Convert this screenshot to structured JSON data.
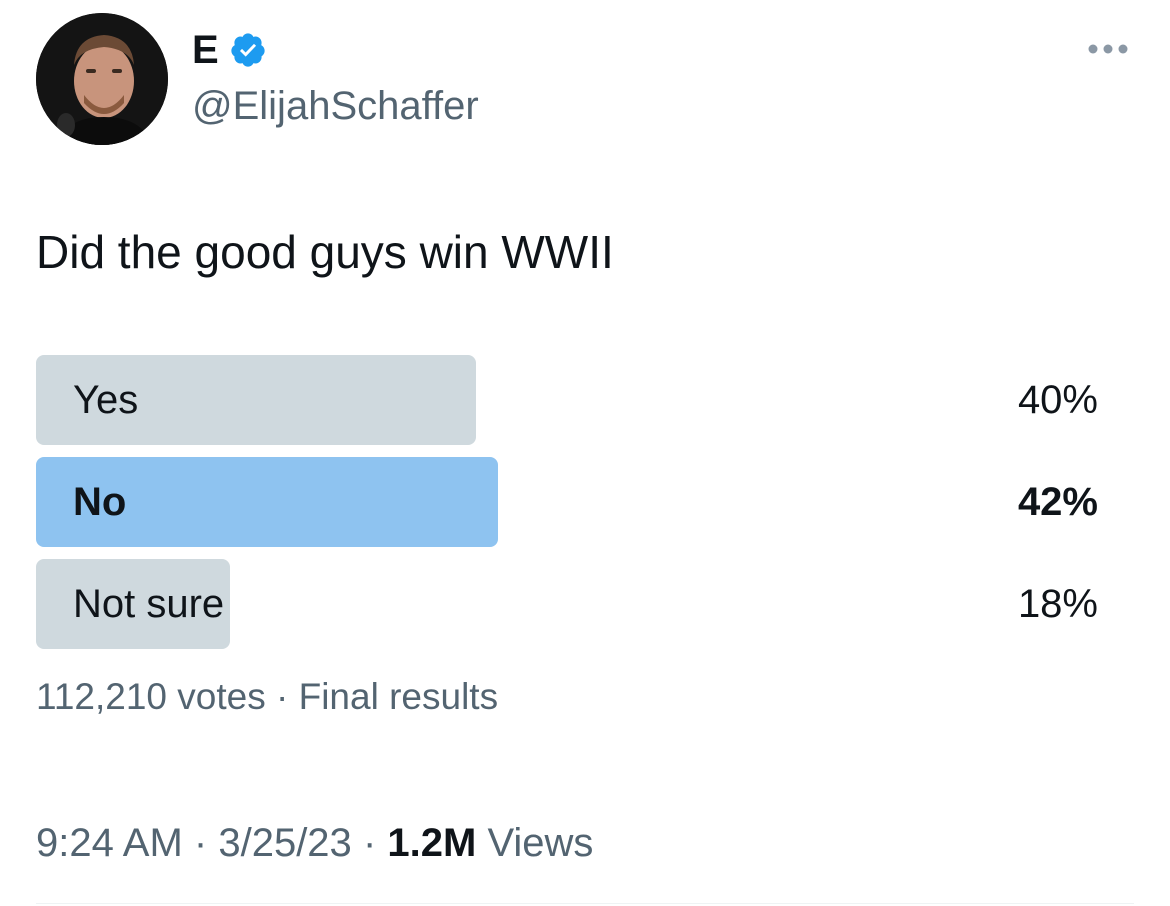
{
  "author": {
    "display_name": "E",
    "handle": "@ElijahSchaffer",
    "avatar_icon": "profile-photo-icon",
    "verified_icon": "verified-badge-icon",
    "verified_color": "#1d9bf0"
  },
  "more_icon": "more-options-icon",
  "tweet": {
    "text": "Did the good guys win WWII"
  },
  "poll": {
    "options": [
      {
        "label": "Yes",
        "percent_text": "40%",
        "fraction": 0.4,
        "winner": false
      },
      {
        "label": "No",
        "percent_text": "42%",
        "fraction": 0.42,
        "winner": true
      },
      {
        "label": "Not sure",
        "percent_text": "18%",
        "fraction": 0.18,
        "winner": false
      }
    ],
    "votes": "112,210 votes",
    "separator": "·",
    "status": "Final results",
    "bar_color": "#cfd9de",
    "winner_bar_color": "#8ec3f0"
  },
  "meta": {
    "time": "9:24 AM",
    "date": "3/25/23",
    "views_count": "1.2M",
    "views_label": "Views",
    "separator": "·"
  }
}
